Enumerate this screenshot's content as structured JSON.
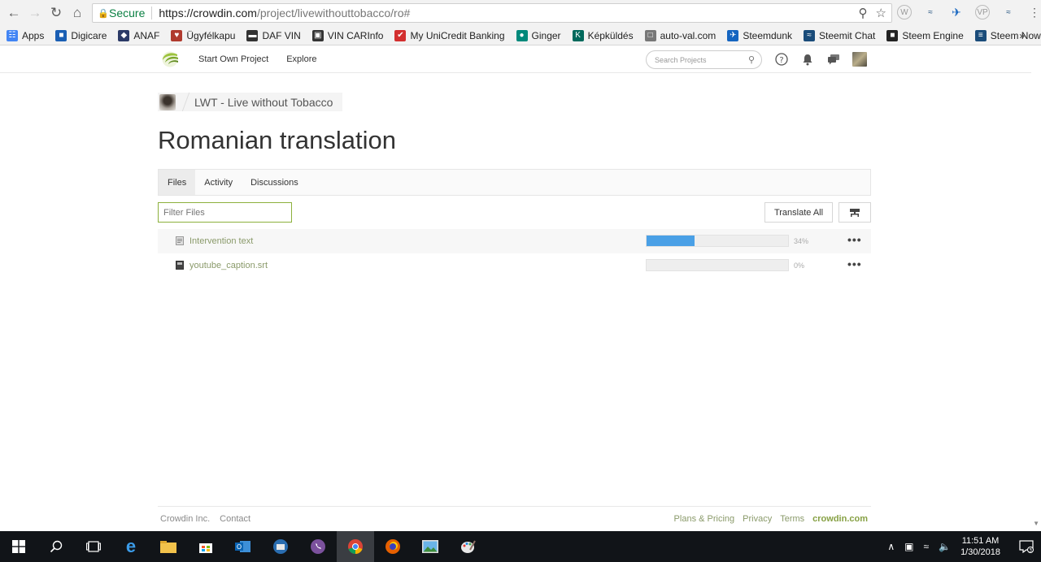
{
  "browser": {
    "secure_label": "Secure",
    "url_host": "https://crowdin.com",
    "url_path": "/project/livewithouttobacco/ro#",
    "bookmarks": [
      {
        "label": "Apps",
        "color": "#4285f4"
      },
      {
        "label": "Digicare",
        "color": "#1a5fb4"
      },
      {
        "label": "ANAF",
        "color": "#2b3a67"
      },
      {
        "label": "Ügyfélkapu",
        "color": "#b03a2e"
      },
      {
        "label": "DAF VIN",
        "color": "#333333"
      },
      {
        "label": "VIN CARInfo",
        "color": "#333333"
      },
      {
        "label": "My UniCredit Banking",
        "color": "#d32f2f"
      },
      {
        "label": "Ginger",
        "color": "#00897b"
      },
      {
        "label": "Képküldés",
        "color": "#00695c"
      },
      {
        "label": "auto-val.com",
        "color": "#777777"
      },
      {
        "label": "Steemdunk",
        "color": "#1565c0"
      },
      {
        "label": "Steemit Chat",
        "color": "#1a4c7a"
      },
      {
        "label": "Steem Engine",
        "color": "#222222"
      },
      {
        "label": "Steem Now",
        "color": "#1a4c7a"
      }
    ],
    "bookmarks_more": "»"
  },
  "header": {
    "nav": [
      "Start Own Project",
      "Explore"
    ],
    "search_placeholder": "Search Projects"
  },
  "breadcrumb": {
    "project": "LWT - Live without Tobacco"
  },
  "page": {
    "title": "Romanian translation"
  },
  "tabs": [
    {
      "label": "Files",
      "active": true
    },
    {
      "label": "Activity",
      "active": false
    },
    {
      "label": "Discussions",
      "active": false
    }
  ],
  "toolbar": {
    "filter_placeholder": "Filter Files",
    "translate_all": "Translate All"
  },
  "files": [
    {
      "name": "Intervention text",
      "progress": 34,
      "progress_label": "34%"
    },
    {
      "name": "youtube_caption.srt",
      "progress": 0,
      "progress_label": "0%"
    }
  ],
  "footer": {
    "left": [
      "Crowdin Inc.",
      "Contact"
    ],
    "right": [
      "Plans & Pricing",
      "Privacy",
      "Terms"
    ],
    "brand": "crowdin.com"
  },
  "taskbar": {
    "time": "11:51 AM",
    "date": "1/30/2018",
    "notifications": "3"
  }
}
